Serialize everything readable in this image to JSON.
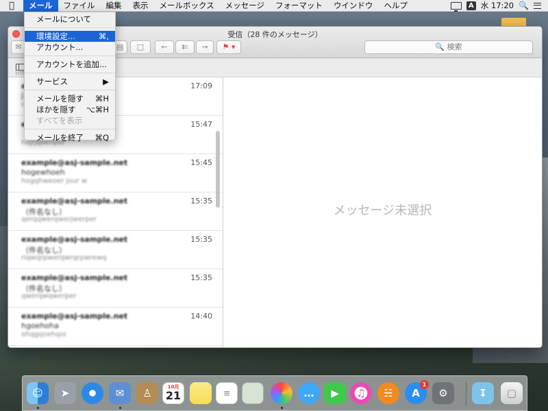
{
  "menubar": {
    "app_menu": "メール",
    "items": [
      "ファイル",
      "編集",
      "表示",
      "メールボックス",
      "メッセージ",
      "フォーマット",
      "ウインドウ",
      "ヘルプ"
    ],
    "ime_label": "A",
    "clock": "水 17:20"
  },
  "dropdown": {
    "items": [
      {
        "label": "メールについて",
        "shortcut": "",
        "state": "normal"
      },
      {
        "label": "環境設定...",
        "shortcut": "⌘,",
        "state": "highlighted"
      },
      {
        "label": "アカウント...",
        "shortcut": "",
        "state": "normal"
      },
      {
        "label": "アカウントを追加...",
        "shortcut": "",
        "state": "normal"
      },
      {
        "label": "サービス",
        "shortcut": "▶",
        "state": "normal"
      },
      {
        "label": "メールを隠す",
        "shortcut": "⌘H",
        "state": "normal"
      },
      {
        "label": "ほかを隠す",
        "shortcut": "⌥⌘H",
        "state": "normal"
      },
      {
        "label": "すべてを表示",
        "shortcut": "",
        "state": "disabled"
      },
      {
        "label": "メールを終了",
        "shortcut": "⌘Q",
        "state": "normal"
      }
    ]
  },
  "window": {
    "title": "受信（28 件のメッセージ）",
    "search_placeholder": "検索",
    "sort_label": "日付"
  },
  "messages": [
    {
      "sender": "a",
      "subject": "j",
      "preview": "c",
      "time": "17:09"
    },
    {
      "sender": "e",
      "subject": "",
      "preview": "hojrjqoerqior",
      "time": "15:47"
    },
    {
      "sender": "example@asj-sample.net",
      "subject": "hogewhoeh",
      "preview": "hogqhweoer jour w",
      "time": "15:45"
    },
    {
      "sender": "example@asj-sample.net",
      "subject": "（件名なし）",
      "preview": "qerqqwerqwerjwerper",
      "time": "15:35"
    },
    {
      "sender": "example@asj-sample.net",
      "subject": "（件名なし）",
      "preview": "riqwqrpwerqwrqrpwrewq",
      "time": "15:35"
    },
    {
      "sender": "example@asj-sample.net",
      "subject": "（件名なし）",
      "preview": "qwerqwqwerper",
      "time": "15:35"
    },
    {
      "sender": "example@asj-sample.net",
      "subject": "hgoehoha",
      "preview": "ohqgqoehqoi",
      "time": "14:40"
    }
  ],
  "viewer": {
    "empty_message": "メッセージ未選択"
  },
  "dock": {
    "calendar_day": "21",
    "calendar_month": "10月",
    "appstore_badge": "1"
  }
}
